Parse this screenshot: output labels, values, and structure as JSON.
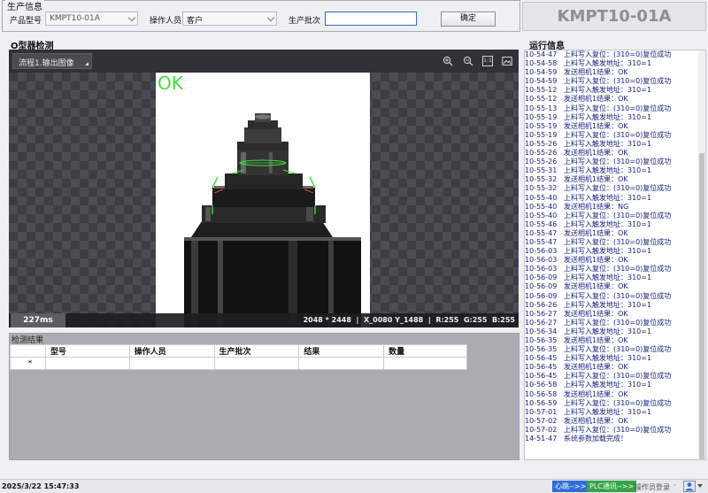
{
  "production_info": {
    "title": "生产信息",
    "product_model_label": "产品型号",
    "product_model_value": "KMPT10-01A",
    "operator_label": "操作人员",
    "operator_value": "客户",
    "batch_label": "生产批次",
    "batch_value": "",
    "confirm_label": "确定"
  },
  "model_banner": "KMPT10-01A",
  "inspection": {
    "title": "O型器检测",
    "flow_select": "流程1.输出图像",
    "result": "OK",
    "elapsed": "227ms",
    "resolution": "2048 * 2448",
    "coords": "X_0080  Y_1488",
    "r": "R:255",
    "g": "G:255",
    "b": "B:255",
    "tool_icons": [
      "zoom-in-icon",
      "zoom-out-icon",
      "actual-size-icon",
      "fit-image-icon"
    ],
    "actual_size_label": "1:1"
  },
  "results": {
    "title": "检测结果",
    "columns": [
      "型号",
      "操作人员",
      "生产批次",
      "结果",
      "数量"
    ],
    "new_row_marker": "*"
  },
  "run_info": {
    "title": "运行信息",
    "lines": [
      {
        "time": "10-54-47",
        "msg": "上料写入复位：(310=0)复位成功"
      },
      {
        "time": "10-54-58",
        "msg": "上料写入触发地址：310=1"
      },
      {
        "time": "10-54-59",
        "msg": "发送相机1结果：OK"
      },
      {
        "time": "10-54-59",
        "msg": "上料写入复位：(310=0)复位成功"
      },
      {
        "time": "10-55-12",
        "msg": "上料写入触发地址：310=1"
      },
      {
        "time": "10-55-12",
        "msg": "发送相机1结果：OK"
      },
      {
        "time": "10-55-13",
        "msg": "上料写入复位：(310=0)复位成功"
      },
      {
        "time": "10-55-19",
        "msg": "上料写入触发地址：310=1"
      },
      {
        "time": "10-55-19",
        "msg": "发送相机1结果：OK"
      },
      {
        "time": "10-55-19",
        "msg": "上料写入复位：(310=0)复位成功"
      },
      {
        "time": "10-55-26",
        "msg": "上料写入触发地址：310=1"
      },
      {
        "time": "10-55-26",
        "msg": "发送相机1结果：OK"
      },
      {
        "time": "10-55-26",
        "msg": "上料写入复位：(310=0)复位成功"
      },
      {
        "time": "10-55-31",
        "msg": "上料写入触发地址：310=1"
      },
      {
        "time": "10-55-32",
        "msg": "发送相机1结果：OK"
      },
      {
        "time": "10-55-32",
        "msg": "上料写入复位：(310=0)复位成功"
      },
      {
        "time": "10-55-40",
        "msg": "上料写入触发地址：310=1"
      },
      {
        "time": "10-55-40",
        "msg": "发送相机1结果：NG"
      },
      {
        "time": "10-55-40",
        "msg": "上料写入复位：(310=0)复位成功"
      },
      {
        "time": "10-55-46",
        "msg": "上料写入触发地址：310=1"
      },
      {
        "time": "10-55-47",
        "msg": "发送相机1结果：OK"
      },
      {
        "time": "10-55-47",
        "msg": "上料写入复位：(310=0)复位成功"
      },
      {
        "time": "10-56-03",
        "msg": "上料写入触发地址：310=1"
      },
      {
        "time": "10-56-03",
        "msg": "发送相机1结果：OK"
      },
      {
        "time": "10-56-03",
        "msg": "上料写入复位：(310=0)复位成功"
      },
      {
        "time": "10-56-09",
        "msg": "上料写入触发地址：310=1"
      },
      {
        "time": "10-56-09",
        "msg": "发送相机1结果：OK"
      },
      {
        "time": "10-56-09",
        "msg": "上料写入复位：(310=0)复位成功"
      },
      {
        "time": "10-56-26",
        "msg": "上料写入触发地址：310=1"
      },
      {
        "time": "10-56-27",
        "msg": "发送相机1结果：OK"
      },
      {
        "time": "10-56-27",
        "msg": "上料写入复位：(310=0)复位成功"
      },
      {
        "time": "10-56-34",
        "msg": "上料写入触发地址：310=1"
      },
      {
        "time": "10-56-35",
        "msg": "发送相机1结果：OK"
      },
      {
        "time": "10-56-35",
        "msg": "上料写入复位：(310=0)复位成功"
      },
      {
        "time": "10-56-45",
        "msg": "上料写入触发地址：310=1"
      },
      {
        "time": "10-56-45",
        "msg": "发送相机1结果：OK"
      },
      {
        "time": "10-56-45",
        "msg": "上料写入复位：(310=0)复位成功"
      },
      {
        "time": "10-56-58",
        "msg": "上料写入触发地址：310=1"
      },
      {
        "time": "10-56-58",
        "msg": "发送相机1结果：OK"
      },
      {
        "time": "10-56-59",
        "msg": "上料写入复位：(310=0)复位成功"
      },
      {
        "time": "10-57-01",
        "msg": "上料写入触发地址：310=1"
      },
      {
        "time": "10-57-02",
        "msg": "发送相机1结果：OK"
      },
      {
        "time": "10-57-02",
        "msg": "上料写入复位：(310=0)复位成功"
      },
      {
        "time": "14-51-47",
        "msg": "系统参数加载完成！"
      }
    ]
  },
  "status_bar": {
    "datetime": "2025/3/22 15:47:33",
    "vision_status": "心跳-->>",
    "plc_status": "PLC通讯-->>",
    "login_label": "操作员登录",
    "separator": "·",
    "vision_color": "#2f6ed8",
    "plc_color": "#35a448"
  },
  "colors": {
    "accent": "#2f6bd3",
    "ok_green": "#40e040",
    "log_text": "#1a237e"
  }
}
